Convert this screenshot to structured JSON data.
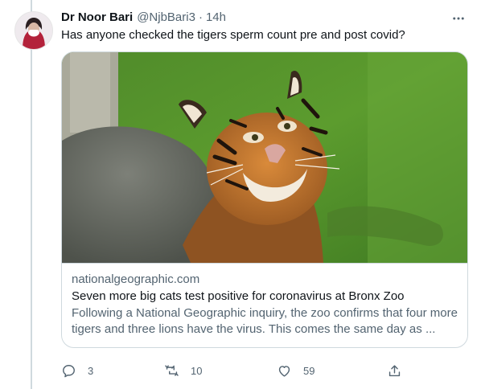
{
  "tweet": {
    "author_name": "Dr Noor Bari",
    "handle": "@NjbBari3",
    "separator": "·",
    "time": "14h",
    "text": "Has anyone checked the tigers sperm count pre and post covid?",
    "more_icon": "more-horizontal-icon"
  },
  "card": {
    "domain": "nationalgeographic.com",
    "title": "Seven more big cats test positive for coronavirus at Bronx Zoo",
    "description": "Following a National Geographic inquiry, the zoo confirms that four more tigers and three lions have the virus. This comes the same day as ...",
    "image": "tiger-photo"
  },
  "actions": {
    "reply_count": "3",
    "retweet_count": "10",
    "like_count": "59",
    "reply_icon": "reply-icon",
    "retweet_icon": "retweet-icon",
    "like_icon": "heart-icon",
    "share_icon": "share-icon"
  },
  "colors": {
    "text_primary": "#0f1419",
    "text_secondary": "#536471",
    "border": "#cfd9de"
  }
}
